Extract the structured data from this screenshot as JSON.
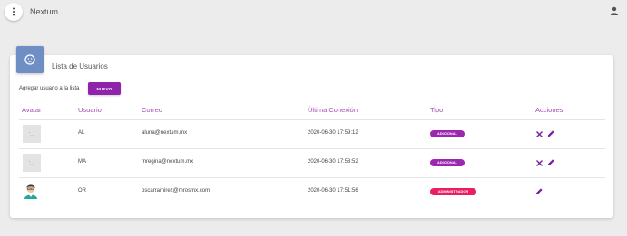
{
  "app": {
    "title": "Nextum"
  },
  "card": {
    "title": "Lista de Usuarios",
    "add_label": "Agregar usuario a la lista",
    "new_button": "NUEVO"
  },
  "table": {
    "headers": [
      "Avatar",
      "Usuario",
      "Correo",
      "Última Conexión",
      "Tipo",
      "Acciones"
    ],
    "rows": [
      {
        "usuario": "AL",
        "correo": "aluna@nextum.mx",
        "ultima_conexion": "2020-06-30 17:59:12",
        "tipo": "ADICIONAL",
        "tipo_color": "#9c27b0",
        "avatar": "placeholder",
        "actions": [
          "close-icon",
          "edit-icon"
        ]
      },
      {
        "usuario": "MA",
        "correo": "mregina@nextum.mx",
        "ultima_conexion": "2020-06-30 17:58:52",
        "tipo": "ADICIONAL",
        "tipo_color": "#9c27b0",
        "avatar": "placeholder",
        "actions": [
          "close-icon",
          "edit-icon"
        ]
      },
      {
        "usuario": "OR",
        "correo": "oscarramirez@mrosmx.com",
        "ultima_conexion": "2020-06-30 17:51:56",
        "tipo": "ADMINISTRADOR",
        "tipo_color": "#e91e63",
        "avatar": "person",
        "actions": [
          "edit-icon"
        ]
      }
    ]
  },
  "colors": {
    "accent": "#8e24aa",
    "header_text": "#a24fb0",
    "card_icon_bg": "#6f8fc4"
  }
}
